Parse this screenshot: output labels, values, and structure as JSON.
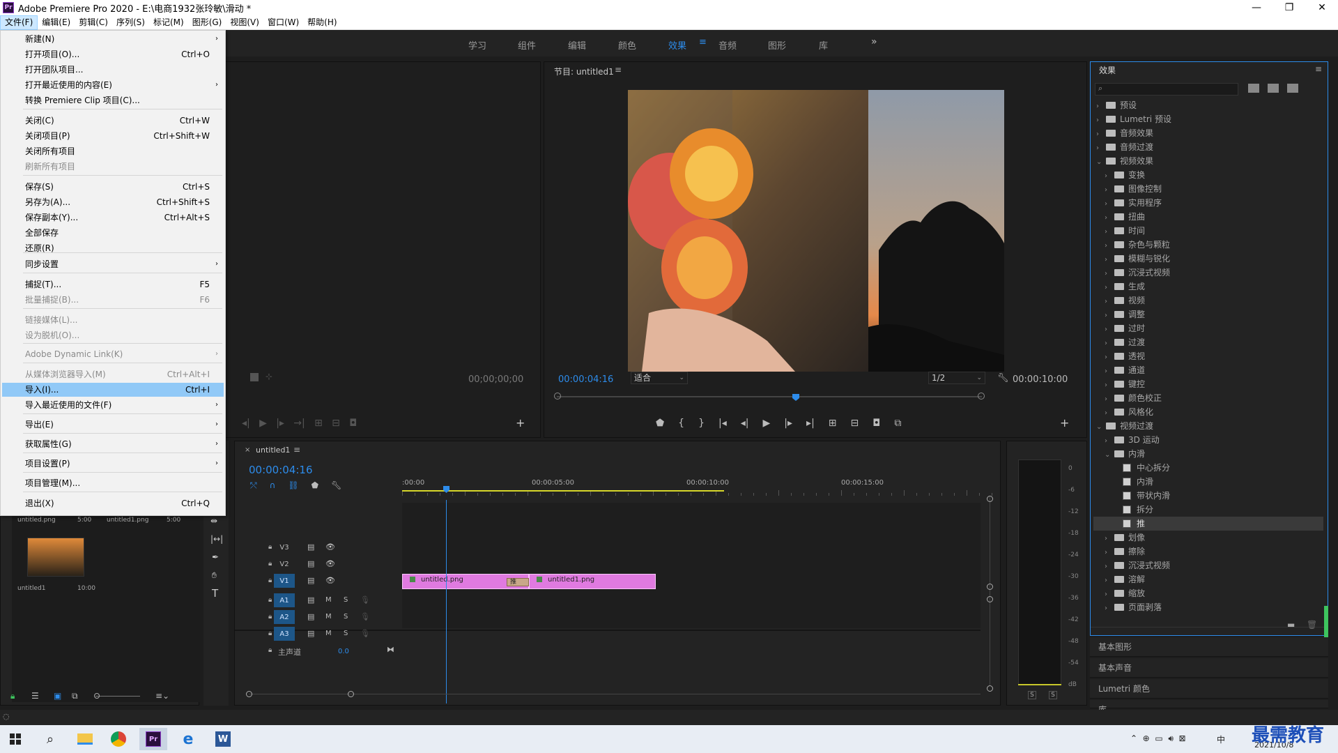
{
  "window": {
    "title": "Adobe Premiere Pro 2020 - E:\\电商1932张玲敏\\滑动 *",
    "logo_text": "Pr"
  },
  "menubar": [
    "文件(F)",
    "编辑(E)",
    "剪辑(C)",
    "序列(S)",
    "标记(M)",
    "图形(G)",
    "视图(V)",
    "窗口(W)",
    "帮助(H)"
  ],
  "workspaces": [
    "学习",
    "组件",
    "编辑",
    "颜色",
    "效果",
    "音频",
    "图形",
    "库"
  ],
  "file_menu": {
    "items": [
      {
        "label": "新建(N)",
        "shortcut": "",
        "submenu": true
      },
      {
        "label": "打开项目(O)...",
        "shortcut": "Ctrl+O"
      },
      {
        "label": "打开团队项目..."
      },
      {
        "label": "打开最近使用的内容(E)",
        "submenu": true
      },
      {
        "label": "转换 Premiere Clip 项目(C)..."
      },
      {
        "label": "关闭(C)",
        "shortcut": "Ctrl+W"
      },
      {
        "label": "关闭项目(P)",
        "shortcut": "Ctrl+Shift+W"
      },
      {
        "label": "关闭所有项目"
      },
      {
        "label": "刷新所有项目",
        "disabled": true
      },
      {
        "label": "保存(S)",
        "shortcut": "Ctrl+S"
      },
      {
        "label": "另存为(A)...",
        "shortcut": "Ctrl+Shift+S"
      },
      {
        "label": "保存副本(Y)...",
        "shortcut": "Ctrl+Alt+S"
      },
      {
        "label": "全部保存"
      },
      {
        "label": "还原(R)"
      },
      {
        "label": "同步设置",
        "submenu": true
      },
      {
        "label": "捕捉(T)...",
        "shortcut": "F5"
      },
      {
        "label": "批量捕捉(B)...",
        "shortcut": "F6",
        "disabled": true
      },
      {
        "label": "链接媒体(L)...",
        "disabled": true
      },
      {
        "label": "设为脱机(O)...",
        "disabled": true
      },
      {
        "label": "Adobe Dynamic Link(K)",
        "disabled": true,
        "submenu": true
      },
      {
        "label": "从媒体浏览器导入(M)",
        "shortcut": "Ctrl+Alt+I",
        "disabled": true
      },
      {
        "label": "导入(I)...",
        "shortcut": "Ctrl+I",
        "highlighted": true
      },
      {
        "label": "导入最近使用的文件(F)",
        "submenu": true
      },
      {
        "label": "导出(E)",
        "submenu": true
      },
      {
        "label": "获取属性(G)",
        "submenu": true
      },
      {
        "label": "项目设置(P)",
        "submenu": true
      },
      {
        "label": "项目管理(M)..."
      },
      {
        "label": "退出(X)",
        "shortcut": "Ctrl+Q"
      }
    ]
  },
  "source_monitor": {
    "timecode": "00;00;00;00"
  },
  "program_monitor": {
    "title": "节目: untitled1",
    "current_time": "00:00:04:16",
    "fit": "适合",
    "resolution": "1/2",
    "duration": "00:00:10:00"
  },
  "project_items": [
    {
      "name": "untitled.png",
      "duration": "5:00"
    },
    {
      "name": "untitled1.png",
      "duration": "5:00"
    },
    {
      "name": "untitled1",
      "duration": "10:00"
    }
  ],
  "timeline": {
    "tab": "untitled1",
    "timecode": "00:00:04:16",
    "ruler": [
      ":00:00",
      "00:00:05:00",
      "00:00:10:00",
      "00:00:15:00"
    ],
    "video_tracks": [
      "V3",
      "V2",
      "V1"
    ],
    "audio_tracks": [
      "A1",
      "A2",
      "A3"
    ],
    "master_label": "主声道",
    "master_value": "0.0",
    "clips": [
      {
        "name": "untitled.png",
        "track": "V1"
      },
      {
        "name": "untitled1.png",
        "track": "V1"
      }
    ],
    "transition_label": "推",
    "mute": "M",
    "solo": "S"
  },
  "meter": {
    "scale": [
      "0",
      "-6",
      "-12",
      "-18",
      "-24",
      "-30",
      "-36",
      "-42",
      "-48",
      "-54",
      "dB"
    ],
    "solo_buttons": [
      "S",
      "S"
    ]
  },
  "effects_panel": {
    "title": "效果",
    "tree": [
      {
        "label": "预设",
        "level": 0,
        "open": false,
        "kind": "folder-star"
      },
      {
        "label": "Lumetri 预设",
        "level": 0,
        "open": false,
        "kind": "folder-star"
      },
      {
        "label": "音频效果",
        "level": 0,
        "open": false,
        "kind": "folder"
      },
      {
        "label": "音频过渡",
        "level": 0,
        "open": false,
        "kind": "folder"
      },
      {
        "label": "视频效果",
        "level": 0,
        "open": true,
        "kind": "folder"
      },
      {
        "label": "变换",
        "level": 1,
        "open": false,
        "kind": "folder"
      },
      {
        "label": "图像控制",
        "level": 1,
        "open": false,
        "kind": "folder"
      },
      {
        "label": "实用程序",
        "level": 1,
        "open": false,
        "kind": "folder"
      },
      {
        "label": "扭曲",
        "level": 1,
        "open": false,
        "kind": "folder"
      },
      {
        "label": "时间",
        "level": 1,
        "open": false,
        "kind": "folder"
      },
      {
        "label": "杂色与颗粒",
        "level": 1,
        "open": false,
        "kind": "folder"
      },
      {
        "label": "模糊与锐化",
        "level": 1,
        "open": false,
        "kind": "folder"
      },
      {
        "label": "沉浸式视频",
        "level": 1,
        "open": false,
        "kind": "folder"
      },
      {
        "label": "生成",
        "level": 1,
        "open": false,
        "kind": "folder"
      },
      {
        "label": "视频",
        "level": 1,
        "open": false,
        "kind": "folder"
      },
      {
        "label": "调整",
        "level": 1,
        "open": false,
        "kind": "folder"
      },
      {
        "label": "过时",
        "level": 1,
        "open": false,
        "kind": "folder"
      },
      {
        "label": "过渡",
        "level": 1,
        "open": false,
        "kind": "folder"
      },
      {
        "label": "透视",
        "level": 1,
        "open": false,
        "kind": "folder"
      },
      {
        "label": "通道",
        "level": 1,
        "open": false,
        "kind": "folder"
      },
      {
        "label": "键控",
        "level": 1,
        "open": false,
        "kind": "folder"
      },
      {
        "label": "颜色校正",
        "level": 1,
        "open": false,
        "kind": "folder"
      },
      {
        "label": "风格化",
        "level": 1,
        "open": false,
        "kind": "folder"
      },
      {
        "label": "视频过渡",
        "level": 0,
        "open": true,
        "kind": "folder"
      },
      {
        "label": "3D 运动",
        "level": 1,
        "open": false,
        "kind": "folder"
      },
      {
        "label": "内滑",
        "level": 1,
        "open": true,
        "kind": "folder"
      },
      {
        "label": "中心拆分",
        "level": 2,
        "kind": "fx"
      },
      {
        "label": "内滑",
        "level": 2,
        "kind": "fx"
      },
      {
        "label": "带状内滑",
        "level": 2,
        "kind": "fx"
      },
      {
        "label": "拆分",
        "level": 2,
        "kind": "fx"
      },
      {
        "label": "推",
        "level": 2,
        "kind": "fx",
        "selected": true
      },
      {
        "label": "划像",
        "level": 1,
        "open": false,
        "kind": "folder"
      },
      {
        "label": "擦除",
        "level": 1,
        "open": false,
        "kind": "folder"
      },
      {
        "label": "沉浸式视频",
        "level": 1,
        "open": false,
        "kind": "folder"
      },
      {
        "label": "溶解",
        "level": 1,
        "open": false,
        "kind": "folder"
      },
      {
        "label": "缩放",
        "level": 1,
        "open": false,
        "kind": "folder"
      },
      {
        "label": "页面剥落",
        "level": 1,
        "open": false,
        "kind": "folder"
      }
    ],
    "sections": [
      "基本图形",
      "基本声音",
      "Lumetri 颜色",
      "库"
    ]
  },
  "taskbar": {
    "ime": "中",
    "date": "2021/10/8",
    "watermark": "最需教育"
  }
}
